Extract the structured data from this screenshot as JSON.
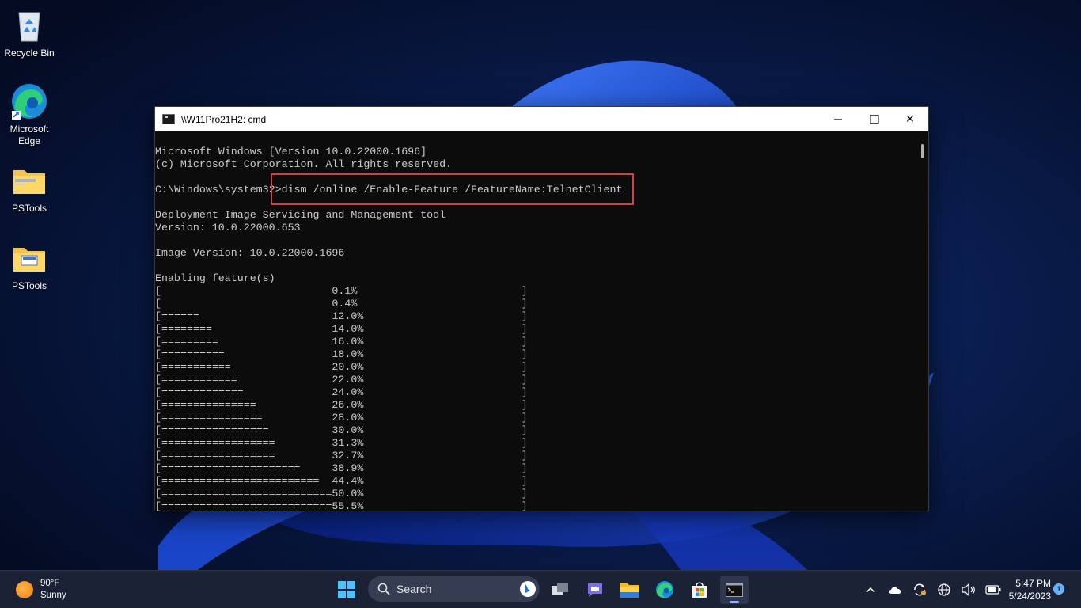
{
  "desktop": {
    "icons": [
      {
        "label": "Recycle Bin",
        "icon": "recycle-bin-icon"
      },
      {
        "label": "Microsoft\nEdge",
        "icon": "edge-icon"
      },
      {
        "label": "PSTools",
        "icon": "zip-folder-icon"
      },
      {
        "label": "PSTools",
        "icon": "folder-icon"
      }
    ]
  },
  "window": {
    "title": "\\\\W11Pro21H2: cmd",
    "controls": {
      "minimize": "—",
      "maximize": "☐",
      "close": "✕"
    }
  },
  "console": {
    "lines": [
      "Microsoft Windows [Version 10.0.22000.1696]",
      "(c) Microsoft Corporation. All rights reserved.",
      "",
      "C:\\Windows\\system32>dism /online /Enable-Feature /FeatureName:TelnetClient",
      "",
      "Deployment Image Servicing and Management tool",
      "Version: 10.0.22000.653",
      "",
      "Image Version: 10.0.22000.1696",
      "",
      "Enabling feature(s)",
      "[                           0.1%                          ]",
      "[                           0.4%                          ]",
      "[======                     12.0%                         ]",
      "[========                   14.0%                         ]",
      "[=========                  16.0%                         ]",
      "[==========                 18.0%                         ]",
      "[===========                20.0%                         ]",
      "[============               22.0%                         ]",
      "[=============              24.0%                         ]",
      "[===============            26.0%                         ]",
      "[================           28.0%                         ]",
      "[=================          30.0%                         ]",
      "[==================         31.3%                         ]",
      "[==================         32.7%                         ]",
      "[======================     38.9%                         ]",
      "[=========================  44.4%                         ]",
      "[===========================50.0%                         ]",
      "[===========================55.5%                         ]"
    ]
  },
  "taskbar": {
    "weather": {
      "temp": "90°F",
      "condition": "Sunny"
    },
    "search_placeholder": "Search",
    "pinned": [
      "windows-start-icon",
      "task-view-icon",
      "teams-chat-icon",
      "file-explorer-icon",
      "edge-icon",
      "microsoft-store-icon",
      "terminal-icon"
    ],
    "tray": [
      "chevron-up-icon",
      "onedrive-cloud-icon",
      "sync-icon",
      "globe-network-icon",
      "speaker-icon",
      "battery-icon"
    ],
    "clock": {
      "time": "5:47 PM",
      "date": "5/24/2023"
    },
    "notification_count": "1"
  },
  "colors": {
    "console_bg": "#0c0c0c",
    "console_text": "#cccccc",
    "highlight": "#e03a3a",
    "taskbar": "#1c2236"
  }
}
